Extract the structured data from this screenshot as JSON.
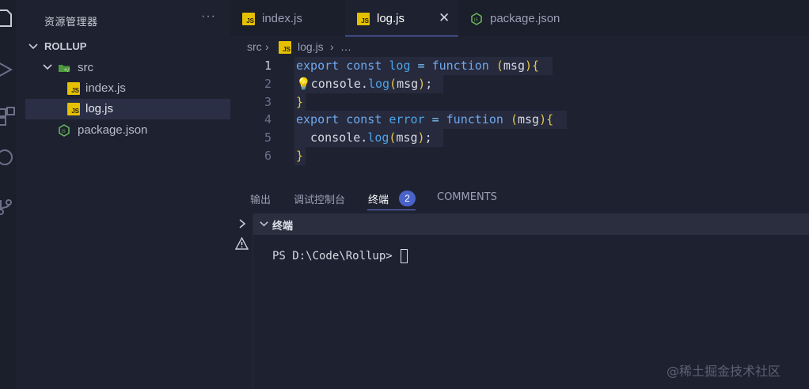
{
  "colors": {
    "accent": "#6b7de3",
    "badge": "#4a63c9",
    "js_icon": "#e5c000",
    "node_icon": "#6cba5a"
  },
  "sidebar": {
    "title": "资源管理器",
    "more": "···",
    "tree": [
      {
        "label": "ROLLUP",
        "icon": "chevron-down-icon"
      },
      {
        "label": "src",
        "icon": "folder-src-icon"
      },
      {
        "label": "index.js",
        "icon": "js-file-icon"
      },
      {
        "label": "log.js",
        "icon": "js-file-icon",
        "selected": true
      },
      {
        "label": "package.json",
        "icon": "node-json-icon"
      }
    ]
  },
  "tabs": [
    {
      "label": "index.js",
      "icon": "js-file-icon"
    },
    {
      "label": "log.js",
      "icon": "js-file-icon",
      "active": true,
      "close": "✕"
    },
    {
      "label": "package.json",
      "icon": "node-json-icon"
    }
  ],
  "breadcrumb": {
    "folder": "src",
    "sep1": "›",
    "file": "log.js",
    "sep2": "›",
    "more": "…"
  },
  "code": {
    "lines": [
      {
        "n": "1",
        "tokens": [
          [
            "kw",
            "export"
          ],
          [
            "pl",
            " "
          ],
          [
            "kw",
            "const"
          ],
          [
            "pl",
            " "
          ],
          [
            "fn",
            "log"
          ],
          [
            "pl",
            " "
          ],
          [
            "op",
            "="
          ],
          [
            "pl",
            " "
          ],
          [
            "kw",
            "function"
          ],
          [
            "pl",
            " "
          ],
          [
            "pr",
            "("
          ],
          [
            "pa",
            "msg"
          ],
          [
            "pr",
            ")"
          ],
          [
            "br",
            "{"
          ]
        ]
      },
      {
        "n": "2",
        "tokens": [
          [
            "pl",
            "💡console."
          ],
          [
            "fn",
            "log"
          ],
          [
            "pr",
            "("
          ],
          [
            "pa",
            "msg"
          ],
          [
            "pr",
            ")"
          ],
          [
            "pl",
            ";"
          ]
        ]
      },
      {
        "n": "3",
        "tokens": [
          [
            "br",
            "}"
          ]
        ]
      },
      {
        "n": "4",
        "tokens": [
          [
            "kw",
            "export"
          ],
          [
            "pl",
            " "
          ],
          [
            "kw",
            "const"
          ],
          [
            "pl",
            " "
          ],
          [
            "fn",
            "error"
          ],
          [
            "pl",
            " "
          ],
          [
            "op",
            "="
          ],
          [
            "pl",
            " "
          ],
          [
            "kw",
            "function"
          ],
          [
            "pl",
            " "
          ],
          [
            "pr",
            "("
          ],
          [
            "pa",
            "msg"
          ],
          [
            "pr",
            ")"
          ],
          [
            "br",
            "{"
          ]
        ]
      },
      {
        "n": "5",
        "tokens": [
          [
            "pl",
            "  console."
          ],
          [
            "fn",
            "log"
          ],
          [
            "pr",
            "("
          ],
          [
            "pa",
            "msg"
          ],
          [
            "pr",
            ")"
          ],
          [
            "pl",
            ";"
          ]
        ]
      },
      {
        "n": "6",
        "tokens": [
          [
            "br",
            "}"
          ]
        ]
      }
    ]
  },
  "panel": {
    "tabs": [
      "输出",
      "调试控制台",
      "终端",
      "COMMENTS"
    ],
    "badge": "2",
    "terminal_title": "终端",
    "prompt": "PS D:\\Code\\Rollup>"
  },
  "watermark": "@稀土掘金技术社区"
}
